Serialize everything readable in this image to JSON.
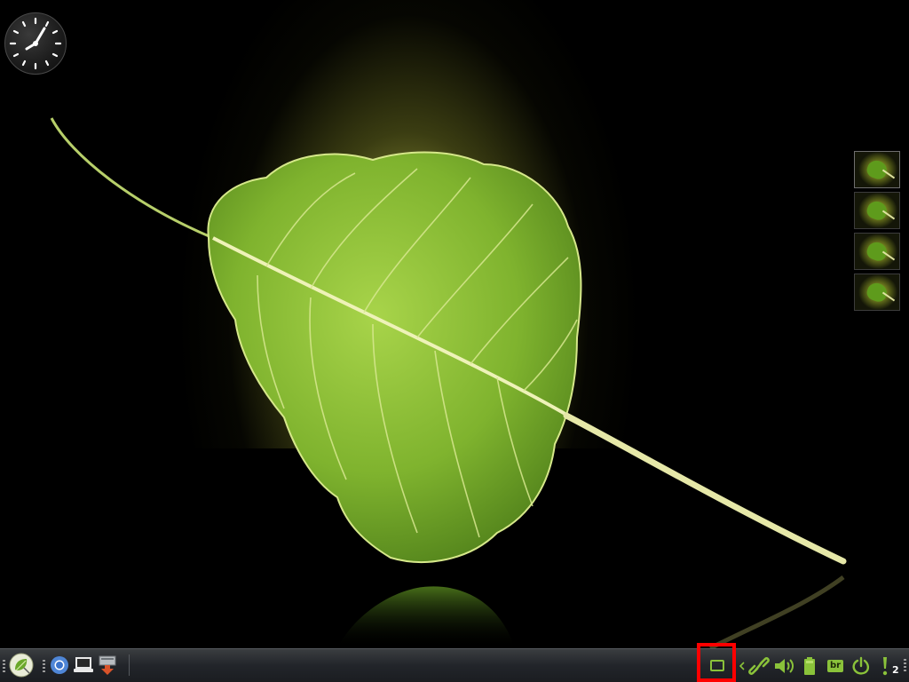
{
  "desktop": {
    "wallpaper_colors": {
      "glow": "#e8ec6e",
      "leaf_light": "#9ccc3c",
      "leaf_dark": "#4a7a18",
      "stem": "#e6e8a8",
      "background": "#000000"
    },
    "workspaces": [
      {
        "name": "workspace-1",
        "active": true
      },
      {
        "name": "workspace-2",
        "active": false
      },
      {
        "name": "workspace-3",
        "active": false
      },
      {
        "name": "workspace-4",
        "active": false
      }
    ],
    "clock_widget": {
      "icon": "analog-clock"
    }
  },
  "taskbar": {
    "launchers": [
      {
        "name": "start-menu",
        "icon": "leaf-logo-icon"
      },
      {
        "name": "chromium",
        "icon": "chromium-icon"
      },
      {
        "name": "file-manager",
        "icon": "laptop-icon"
      },
      {
        "name": "software-install",
        "icon": "download-icon"
      }
    ],
    "tray": {
      "show_desktop": {
        "icon": "show-desktop-icon"
      },
      "expand_arrow": {
        "icon": "chevron-left-icon"
      },
      "network": {
        "icon": "link-icon"
      },
      "volume": {
        "icon": "speaker-icon"
      },
      "battery": {
        "icon": "battery-icon"
      },
      "keyboard_layout": {
        "label": "br"
      },
      "power": {
        "icon": "power-icon"
      },
      "notifications": {
        "icon": "exclamation-icon",
        "count": "2"
      }
    },
    "accent_color": "#8ac23a"
  }
}
